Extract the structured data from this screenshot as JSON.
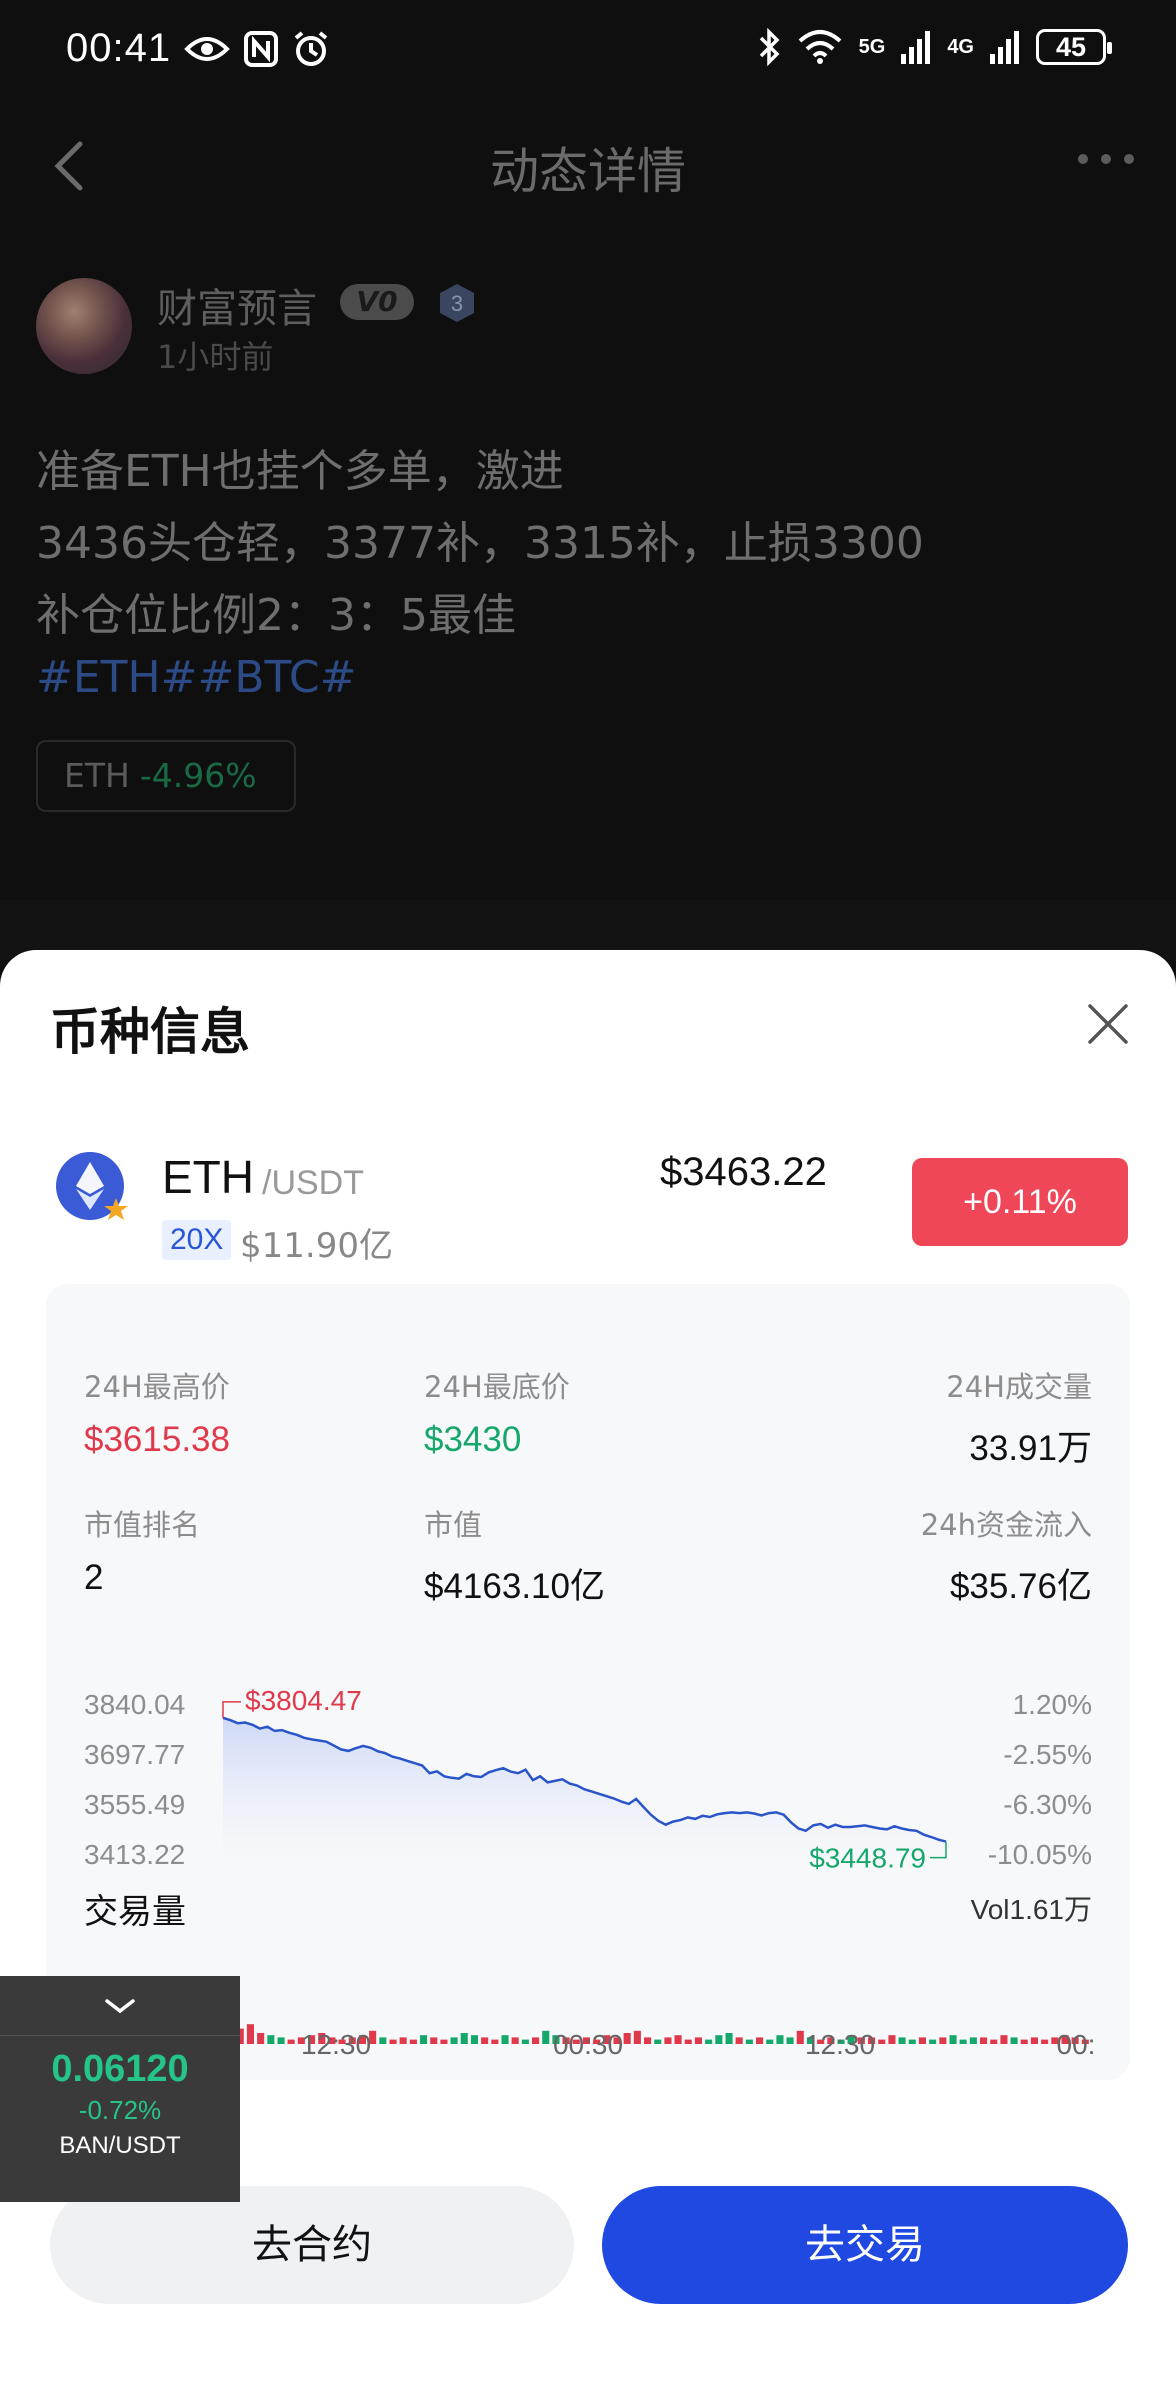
{
  "status_bar": {
    "time": "00:41",
    "network": "5G",
    "network2": "4G",
    "battery": "45"
  },
  "nav": {
    "title": "动态详情"
  },
  "post": {
    "author": "财富预言",
    "vip_badge": "V0",
    "level": "3",
    "time_ago": "1小时前",
    "lines": [
      "准备ETH也挂个多单，激进",
      "3436头仓轻，3377补，3315补，止损3300",
      "补仓位比例2：3：5最佳"
    ],
    "hashtags": "#ETH##BTC#",
    "coin_chip": {
      "symbol": "ETH",
      "change": "-4.96%"
    }
  },
  "sheet": {
    "title": "币种信息",
    "coin": {
      "base": "ETH",
      "quote": "/USDT",
      "leverage": "20X",
      "market_cap_short": "$11.90亿",
      "price": "$3463.22",
      "change": "+0.11%"
    },
    "stats": {
      "high_label": "24H最高价",
      "high_value": "$3615.38",
      "low_label": "24H最底价",
      "low_value": "$3430",
      "volume_label": "24H成交量",
      "volume_value": "33.91万",
      "rank_label": "市值排名",
      "rank_value": "2",
      "cap_label": "市值",
      "cap_value": "$4163.10亿",
      "inflow_label": "24h资金流入",
      "inflow_value": "$35.76亿"
    },
    "volume_title": "交易量",
    "volume_total": "Vol1.61万",
    "buttons": {
      "contract": "去合约",
      "trade": "去交易"
    }
  },
  "chart_data": {
    "type": "area",
    "y_ticks": [
      "3840.04",
      "3697.77",
      "3555.49",
      "3413.22"
    ],
    "y_pct_ticks": [
      "1.20%",
      "-2.55%",
      "-6.30%",
      "-10.05%"
    ],
    "x_ticks": [
      "12:30",
      "00:30",
      "12:30",
      "00:"
    ],
    "ylim": [
      3413.22,
      3840.04
    ],
    "high_label": "$3804.47",
    "low_label": "$3448.79",
    "values": [
      3804,
      3798,
      3790,
      3792,
      3786,
      3776,
      3781,
      3770,
      3772,
      3765,
      3760,
      3752,
      3748,
      3745,
      3742,
      3732,
      3722,
      3718,
      3725,
      3731,
      3726,
      3717,
      3712,
      3703,
      3698,
      3692,
      3686,
      3680,
      3660,
      3665,
      3652,
      3648,
      3646,
      3658,
      3652,
      3650,
      3662,
      3668,
      3673,
      3664,
      3660,
      3669,
      3642,
      3652,
      3636,
      3640,
      3644,
      3633,
      3628,
      3618,
      3612,
      3606,
      3600,
      3594,
      3586,
      3580,
      3593,
      3572,
      3552,
      3536,
      3526,
      3534,
      3538,
      3545,
      3541,
      3549,
      3546,
      3553,
      3556,
      3558,
      3556,
      3558,
      3555,
      3550,
      3556,
      3558,
      3552,
      3532,
      3516,
      3510,
      3524,
      3528,
      3518,
      3526,
      3520,
      3520,
      3522,
      3524,
      3520,
      3516,
      3514,
      3522,
      3516,
      3512,
      3510,
      3500,
      3494,
      3487,
      3482
    ],
    "volumes": [
      2,
      3,
      4,
      2,
      3,
      5,
      3,
      2,
      4,
      6,
      3,
      2,
      3,
      4,
      3,
      7,
      9,
      5,
      4,
      3,
      2,
      3,
      4,
      5,
      3,
      2,
      3,
      4,
      6,
      3,
      2,
      3,
      2,
      4,
      3,
      2,
      3,
      5,
      4,
      3,
      2,
      4,
      3,
      2,
      3,
      6,
      4,
      3,
      2,
      3,
      2,
      4,
      3,
      5,
      6,
      3,
      2,
      3,
      4,
      2,
      3,
      2,
      4,
      5,
      3,
      2,
      3,
      2,
      4,
      3,
      6,
      3,
      2,
      3,
      2,
      4,
      3,
      3,
      2,
      4,
      3,
      2,
      3,
      2,
      3,
      4,
      2,
      3,
      3,
      2,
      4,
      3,
      2,
      3,
      2,
      3,
      4,
      3,
      2
    ],
    "up_color": "#16a76b",
    "down_color": "#e0394b",
    "line_color": "#2a55c9"
  },
  "ticker": {
    "price": "0.06120",
    "change": "-0.72%",
    "pair": "BAN/USDT"
  }
}
